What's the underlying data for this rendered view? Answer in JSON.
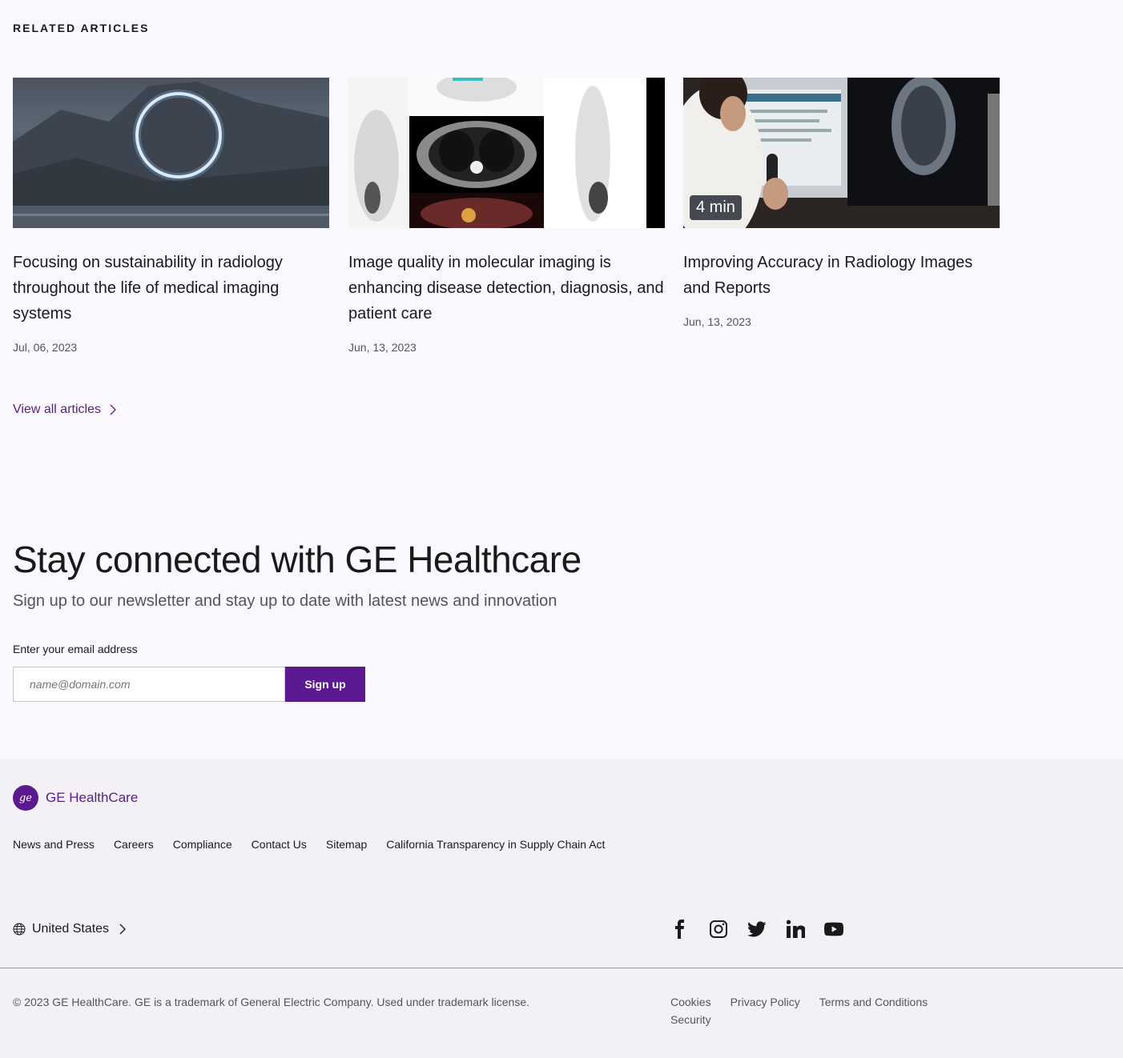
{
  "related": {
    "heading": "RELATED ARTICLES",
    "articles": [
      {
        "title": "Focusing on sustainability in radiology throughout the life of medical imaging systems",
        "date": "Jul, 06, 2023"
      },
      {
        "title": "Image quality in molecular imaging is enhancing disease detection, diagnosis, and patient care",
        "date": "Jun, 13, 2023"
      },
      {
        "title": "Improving Accuracy in Radiology Images and Reports",
        "date": "Jun, 13, 2023",
        "badge": "4 min"
      }
    ],
    "view_all": "View all articles"
  },
  "newsletter": {
    "title": "Stay connected with GE Healthcare",
    "subtitle": "Sign up to our newsletter and stay up to date with latest news and innovation",
    "email_label": "Enter your email address",
    "email_placeholder": "name@domain.com",
    "signup_label": "Sign up"
  },
  "footer": {
    "logo_text": "GE HealthCare",
    "links": [
      "News and Press",
      "Careers",
      "Compliance",
      "Contact Us",
      "Sitemap",
      "California Transparency in Supply Chain Act"
    ],
    "region": "United States",
    "social": [
      "facebook-icon",
      "instagram-icon",
      "twitter-icon",
      "linkedin-icon",
      "youtube-icon"
    ],
    "copyright": "© 2023 GE HealthCare. GE is a trademark of General Electric Company. Used under trademark license.",
    "legal": [
      "Cookies",
      "Privacy Policy",
      "Terms and Conditions",
      "Security"
    ]
  },
  "colors": {
    "accent": "#5c1a92",
    "footer_bg": "#f3f1f6",
    "page_bg": "#faf8fc"
  }
}
